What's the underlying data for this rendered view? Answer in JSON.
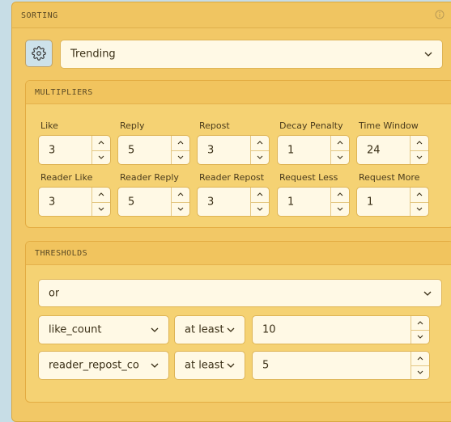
{
  "panel": {
    "title": "SORTING"
  },
  "sort": {
    "value": "Trending"
  },
  "multipliers": {
    "title": "MULTIPLIERS",
    "rows": [
      [
        {
          "label": "Like",
          "value": "3"
        },
        {
          "label": "Reply",
          "value": "5"
        },
        {
          "label": "Repost",
          "value": "3"
        },
        {
          "label": "Decay Penalty",
          "value": "1"
        },
        {
          "label": "Time Window",
          "value": "24"
        }
      ],
      [
        {
          "label": "Reader Like",
          "value": "3"
        },
        {
          "label": "Reader Reply",
          "value": "5"
        },
        {
          "label": "Reader Repost",
          "value": "3"
        },
        {
          "label": "Request Less",
          "value": "1"
        },
        {
          "label": "Request More",
          "value": "1"
        }
      ]
    ]
  },
  "thresholds": {
    "title": "THRESHOLDS",
    "operator": "or",
    "rules": [
      {
        "field": "like_count",
        "comparator": "at least",
        "value": "10"
      },
      {
        "field": "reader_repost_count",
        "comparator": "at least",
        "value": "5"
      }
    ]
  },
  "icons": [
    "info-icon",
    "gear-icon",
    "chevron-down-icon",
    "chevron-up-icon"
  ]
}
